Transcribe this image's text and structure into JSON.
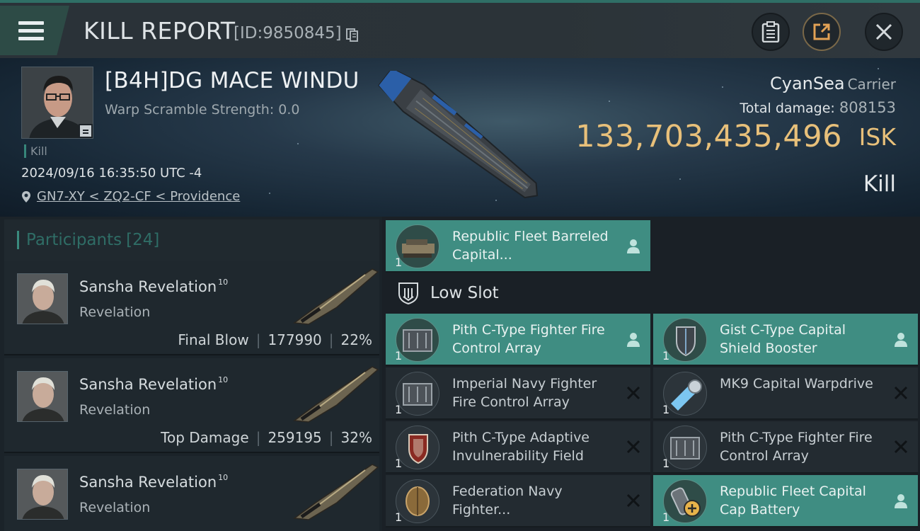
{
  "header": {
    "title": "KILL REPORT",
    "kill_id": "[ID:9850845]"
  },
  "victim": {
    "name": "[B4H]DG MACE WINDU",
    "warp_scramble": "Warp Scramble Strength: 0.0",
    "kill_tag": "Kill",
    "time": "2024/09/16 16:35:50 UTC -4",
    "location": "GN7-XY < ZQ2-CF < Providence",
    "corp": "CyanSea",
    "ship_class": "Carrier",
    "total_damage_label": "Total damage:",
    "total_damage": "808153",
    "isk_value": "133,703,435,496",
    "isk_unit": "ISK",
    "outcome": "Kill"
  },
  "participants": {
    "label": "Participants",
    "count": "[24]",
    "items": [
      {
        "name": "Sansha Revelation",
        "level": "10",
        "ship": "Revelation",
        "tag": "Final Blow",
        "damage": "177990",
        "percent": "22%"
      },
      {
        "name": "Sansha Revelation",
        "level": "10",
        "ship": "Revelation",
        "tag": "Top Damage",
        "damage": "259195",
        "percent": "32%"
      },
      {
        "name": "Sansha Revelation",
        "level": "10",
        "ship": "Revelation"
      }
    ]
  },
  "modules": {
    "top_item": {
      "name": "Republic Fleet Barreled Capital...",
      "qty": "1",
      "status": "dropped"
    },
    "low_slot_label": "Low Slot",
    "low_slot": [
      {
        "name": "Pith C-Type Fighter Fire Control Array",
        "qty": "1",
        "status": "dropped"
      },
      {
        "name": "Gist C-Type Capital Shield Booster",
        "qty": "1",
        "status": "dropped"
      },
      {
        "name": "Imperial Navy Fighter Fire Control Array",
        "qty": "1",
        "status": "destroyed"
      },
      {
        "name": "MK9 Capital Warpdrive",
        "qty": "1",
        "status": "destroyed"
      },
      {
        "name": "Pith C-Type Adaptive Invulnerability Field",
        "qty": "1",
        "status": "destroyed"
      },
      {
        "name": "Pith C-Type Fighter Fire Control Array",
        "qty": "1",
        "status": "destroyed"
      },
      {
        "name": "Federation Navy Fighter...",
        "qty": "1",
        "status": "destroyed"
      },
      {
        "name": "Republic Fleet Capital Cap Battery",
        "qty": "1",
        "status": "dropped"
      }
    ]
  },
  "colors": {
    "accent": "#3f8d82",
    "isk": "#e8c07a",
    "background": "#1a2026"
  }
}
